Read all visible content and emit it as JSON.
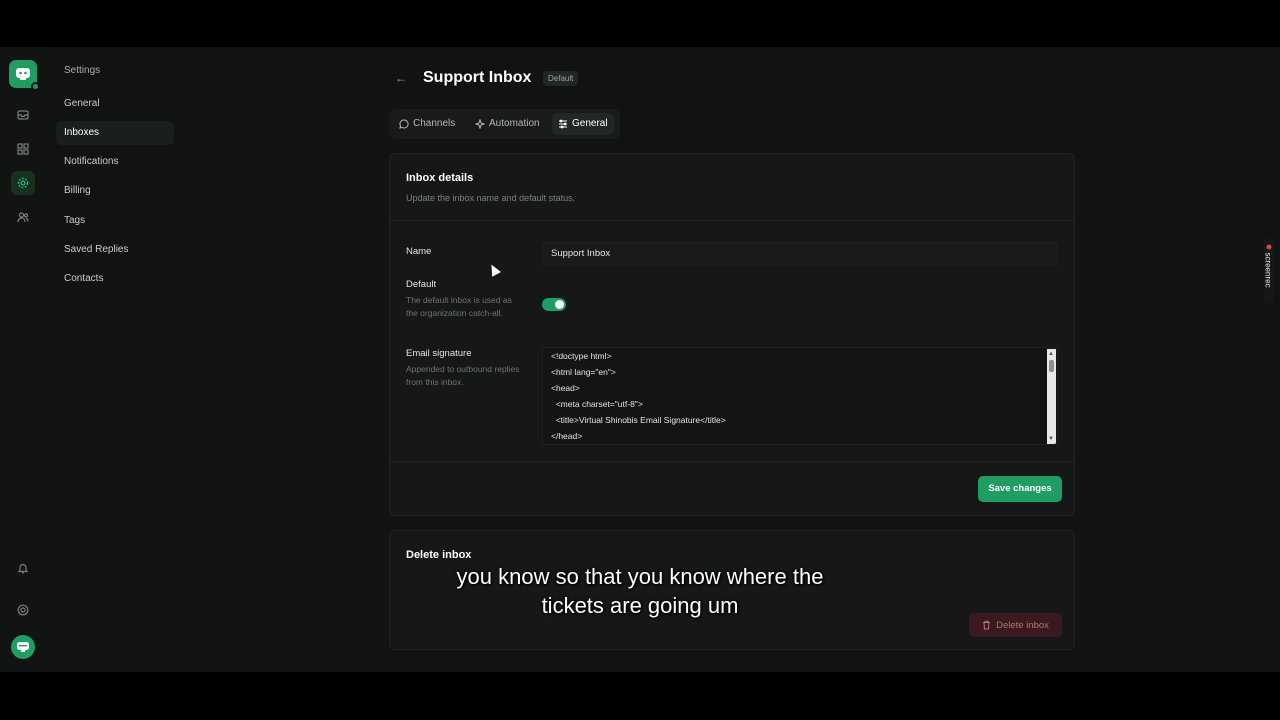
{
  "nav": {
    "title": "Settings",
    "items": [
      {
        "label": "General",
        "active": false
      },
      {
        "label": "Inboxes",
        "active": true
      },
      {
        "label": "Notifications",
        "active": false
      },
      {
        "label": "Billing",
        "active": false
      },
      {
        "label": "Tags",
        "active": false
      },
      {
        "label": "Saved Replies",
        "active": false
      },
      {
        "label": "Contacts",
        "active": false
      }
    ]
  },
  "rail": {
    "icons": [
      "logo-icon",
      "inbox-icon",
      "apps-icon",
      "settings-icon",
      "users-icon",
      "bell-icon",
      "help-icon",
      "avatar-icon"
    ],
    "active": "settings-icon"
  },
  "header": {
    "back": "←",
    "title": "Support Inbox",
    "badge": "Default"
  },
  "tabs": [
    {
      "label": "Channels",
      "icon": "chat-icon",
      "active": false
    },
    {
      "label": "Automation",
      "icon": "sparkle-icon",
      "active": false
    },
    {
      "label": "General",
      "icon": "sliders-icon",
      "active": true
    }
  ],
  "details": {
    "title": "Inbox details",
    "subtitle": "Update the inbox name and default status.",
    "name_label": "Name",
    "name_value": "Support Inbox",
    "default_label": "Default",
    "default_help": "The default inbox is used as the organization catch-all.",
    "default_on": true,
    "signature_label": "Email signature",
    "signature_help": "Appended to outbound replies from this inbox.",
    "signature_lines": [
      "<!doctype html>",
      "<html lang=\"en\">",
      "<head>",
      "  <meta charset=\"utf-8\">",
      "  <title>Virtual Shinobis Email Signature</title>",
      "</head>"
    ],
    "save_label": "Save changes"
  },
  "delete": {
    "title": "Delete inbox",
    "button_label": "Delete inbox"
  },
  "watermark": "screenrec",
  "subtitles": [
    "you know so that you know where the",
    "tickets are going um"
  ],
  "colors": {
    "accent": "#1f9d62",
    "danger_bg": "#3a1a1e",
    "background": "#111312"
  }
}
